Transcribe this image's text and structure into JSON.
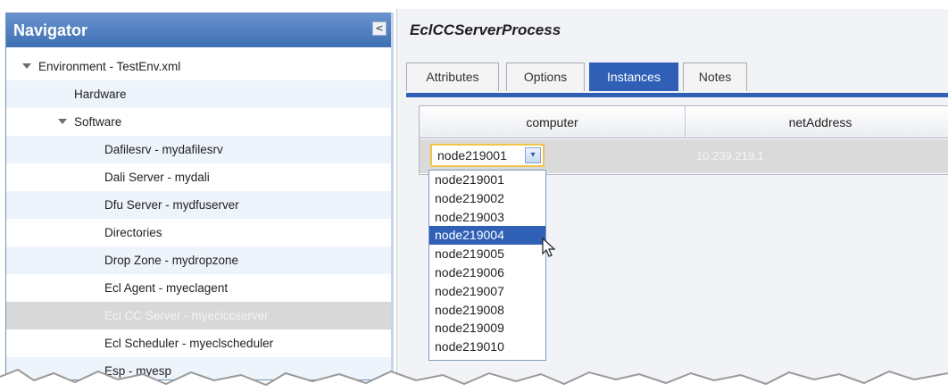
{
  "navigator": {
    "title": "Navigator",
    "collapse_glyph": "<",
    "items": [
      {
        "label": "Environment - TestEnv.xml",
        "indent": 0,
        "expanded": true
      },
      {
        "label": "Hardware",
        "indent": 1,
        "expanded": false
      },
      {
        "label": "Software",
        "indent": 1,
        "expanded": true
      },
      {
        "label": "Dafilesrv - mydafilesrv",
        "indent": 2
      },
      {
        "label": "Dali Server - mydali",
        "indent": 2
      },
      {
        "label": "Dfu Server - mydfuserver",
        "indent": 2
      },
      {
        "label": "Directories",
        "indent": 2
      },
      {
        "label": "Drop Zone - mydropzone",
        "indent": 2
      },
      {
        "label": "Ecl Agent - myeclagent",
        "indent": 2
      },
      {
        "label": "Ecl CC Server - myeclccserver",
        "indent": 2,
        "selected": true
      },
      {
        "label": "Ecl Scheduler - myeclscheduler",
        "indent": 2
      },
      {
        "label": "Esp - myesp",
        "indent": 2
      }
    ]
  },
  "panel": {
    "title": "EclCCServerProcess",
    "tabs": [
      {
        "label": "Attributes",
        "active": false
      },
      {
        "label": "Options",
        "active": false
      },
      {
        "label": "Instances",
        "active": true
      },
      {
        "label": "Notes",
        "active": false
      }
    ],
    "grid": {
      "columns": [
        "computer",
        "netAddress"
      ],
      "row": {
        "computer": "node219001",
        "netAddress": "10.239.219.1"
      }
    }
  },
  "computer_dropdown": {
    "selected_value": "node219001",
    "arrow_glyph": "▾",
    "highlighted": "node219004",
    "options": [
      "node219001",
      "node219002",
      "node219003",
      "node219004",
      "node219005",
      "node219006",
      "node219007",
      "node219008",
      "node219009",
      "node219010"
    ]
  },
  "colors": {
    "accent": "#2f60b6",
    "nav_header": "#3e6fb4",
    "selected_row": "#d8d8d8",
    "dropdown_focus": "#f0c54a"
  }
}
